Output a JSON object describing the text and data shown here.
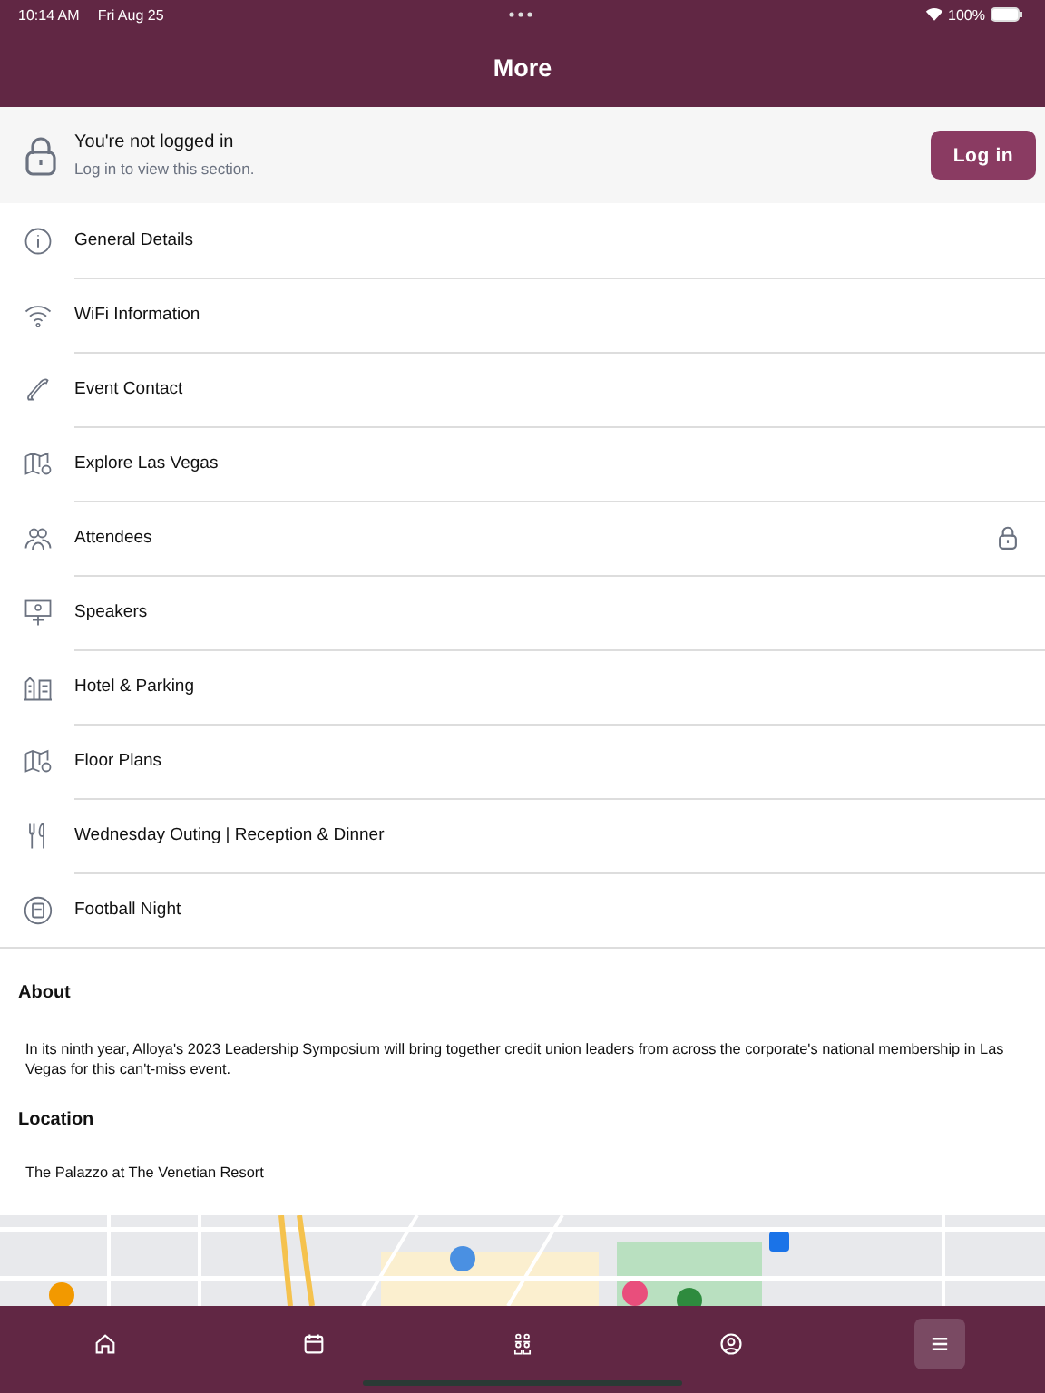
{
  "status_bar": {
    "time": "10:14 AM",
    "date": "Fri Aug 25",
    "battery": "100%"
  },
  "header": {
    "title": "More"
  },
  "login_banner": {
    "title": "You're not logged in",
    "subtitle": "Log in to view this section.",
    "button": "Log in"
  },
  "menu": [
    {
      "label": "General Details",
      "locked": false
    },
    {
      "label": "WiFi Information",
      "locked": false
    },
    {
      "label": "Event Contact",
      "locked": false
    },
    {
      "label": "Explore Las Vegas",
      "locked": false
    },
    {
      "label": "Attendees",
      "locked": true
    },
    {
      "label": "Speakers",
      "locked": false
    },
    {
      "label": "Hotel & Parking",
      "locked": false
    },
    {
      "label": "Floor Plans",
      "locked": false
    },
    {
      "label": "Wednesday Outing | Reception & Dinner",
      "locked": false
    },
    {
      "label": "Football Night",
      "locked": false
    }
  ],
  "about": {
    "heading": "About",
    "text": "In its ninth year, Alloya's 2023 Leadership Symposium will bring together credit union leaders from across the corporate's national membership in Las Vegas for this can't-miss event."
  },
  "location": {
    "heading": "Location",
    "text": "The Palazzo at The Venetian Resort"
  },
  "tab_bar": [
    {
      "selected": false
    },
    {
      "selected": false
    },
    {
      "selected": false
    },
    {
      "selected": false
    },
    {
      "selected": true
    }
  ]
}
